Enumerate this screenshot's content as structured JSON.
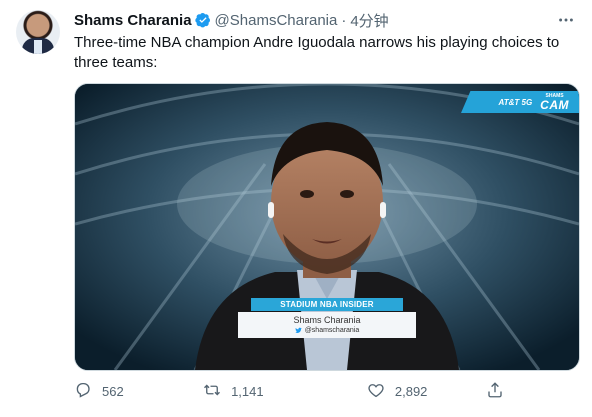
{
  "tweet": {
    "author_name": "Shams Charania",
    "handle": "@ShamsCharania",
    "separator": "·",
    "time": "4分钟",
    "text": "Three-time NBA champion Andre Iguodala narrows his playing choices to three teams:",
    "verified_color": "#1d9bf0"
  },
  "media": {
    "lower_third_title": "STADIUM NBA INSIDER",
    "lower_third_name": "Shams Charania",
    "lower_third_handle": "@shamscharania",
    "cam_brand": "AT&T 5G",
    "cam_label_small": "SHAMS",
    "cam_label_big": "CAM"
  },
  "actions": {
    "reply_count": "562",
    "retweet_count": "1,141",
    "like_count": "2,892",
    "icons": [
      "reply-icon",
      "retweet-icon",
      "like-icon",
      "share-icon"
    ]
  }
}
